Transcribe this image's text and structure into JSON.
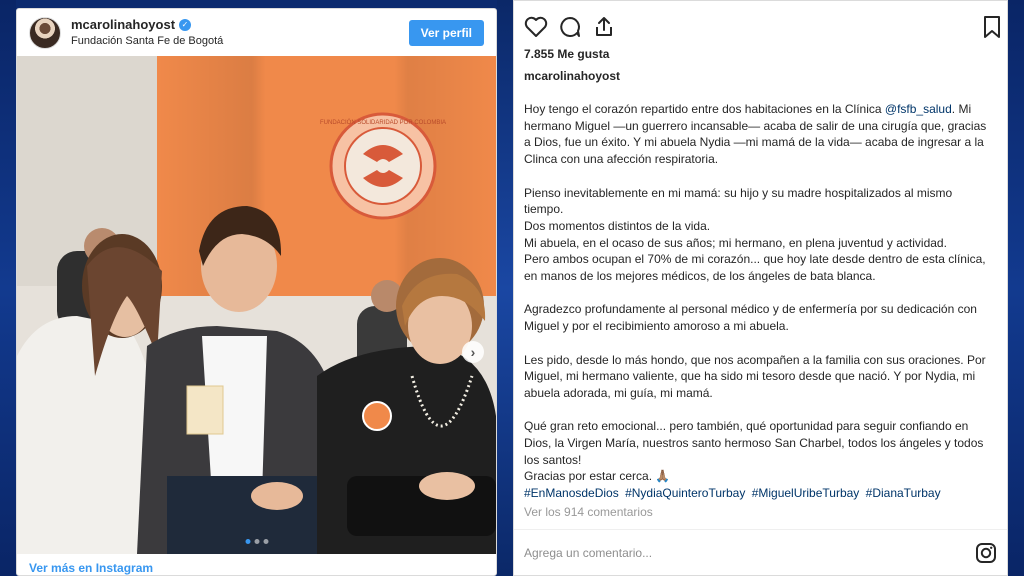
{
  "post": {
    "username": "mcarolinahoyost",
    "location": "Fundación Santa Fe de Bogotá",
    "view_profile_label": "Ver perfil",
    "view_more_label": "Ver más en Instagram",
    "carousel": {
      "total": 3,
      "current": 1
    }
  },
  "photo": {
    "banner_text": "FUNDACIÓN SOLIDARIDAD POR COLOMBIA",
    "brand_orange": "#f0894a"
  },
  "details": {
    "likes": "7.855 Me gusta",
    "owner": "mcarolinahoyost",
    "caption": {
      "p1_before": "Hoy tengo el corazón repartido entre dos habitaciones en la Clínica ",
      "p1_mention": "@fsfb_salud",
      "p1_after": ". Mi hermano Miguel —un guerrero incansable— acaba de salir de una cirugía que, gracias a Dios, fue un éxito. Y mi abuela Nydia —mi mamá de la vida— acaba de ingresar a la Clinca con una afección respiratoria.",
      "p2": "Pienso inevitablemente en mi mamá: su hijo y su madre hospitalizados al mismo tiempo.",
      "p3": "Dos momentos distintos de la vida.",
      "p4": "Mi abuela, en el ocaso de sus años; mi hermano, en plena juventud y actividad.",
      "p5": "Pero ambos ocupan el 70% de mi corazón... que hoy late desde dentro de esta clínica, en manos de los mejores médicos, de los ángeles de bata blanca.",
      "p6": "Agradezco profundamente al personal médico y de enfermería por su dedicación con Miguel y por el recibimiento amoroso a mi abuela.",
      "p7": "Les pido, desde lo más hondo, que nos acompañen a la familia con sus oraciones. Por Miguel, mi hermano valiente, que ha sido mi tesoro desde que nació. Y por Nydia, mi abuela adorada, mi guía, mi mamá.",
      "p8": "Qué gran reto emocional... pero también, qué oportunidad para seguir confiando en Dios, la Virgen María, nuestros santo hermoso San Charbel, todos los ángeles y todos los santos!",
      "p9": "Gracias por estar cerca. 🙏🏽",
      "hashtags": [
        "#EnManosdeDios",
        "#NydiaQuinteroTurbay",
        "#MiguelUribeTurbay",
        "#DianaTurbay"
      ]
    },
    "comments_link": "Ver los 914 comentarios",
    "comment_placeholder": "Agrega un comentario...",
    "colors": {
      "link": "#3897f0",
      "hashtag": "#003569",
      "text": "#262626"
    }
  }
}
